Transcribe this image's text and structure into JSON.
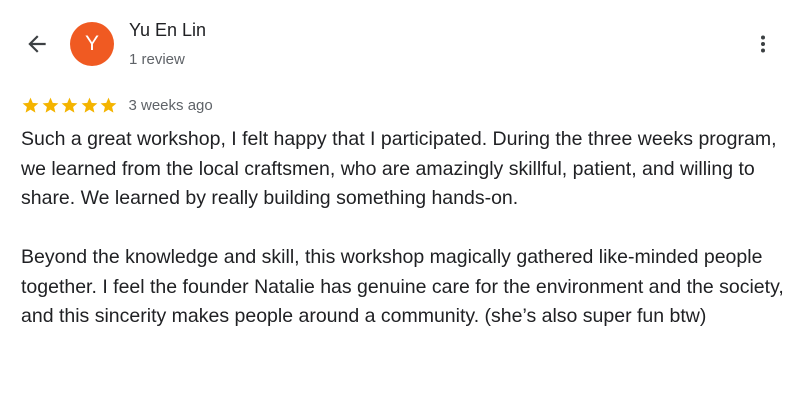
{
  "header": {
    "back_icon": "arrow-back-icon",
    "avatar_initial": "Y",
    "avatar_color": "#f05a22",
    "reviewer_name": "Yu En Lin",
    "review_count": "1 review",
    "more_icon": "more-vertical-icon"
  },
  "review": {
    "rating": 5,
    "max_rating": 5,
    "star_color": "#f4b400",
    "time_ago": "3 weeks ago",
    "paragraphs": [
      "Such a great workshop, I felt happy that I participated. During the three weeks program, we learned from the local craftsmen, who are amazingly skillful, patient, and willing to share. We learned by really building something hands-on.",
      "Beyond the knowledge and skill, this workshop magically gathered like-minded people together. I feel the founder Natalie has genuine care for the environment and the society, and this sincerity makes people around a community. (she’s also super fun btw)"
    ]
  }
}
